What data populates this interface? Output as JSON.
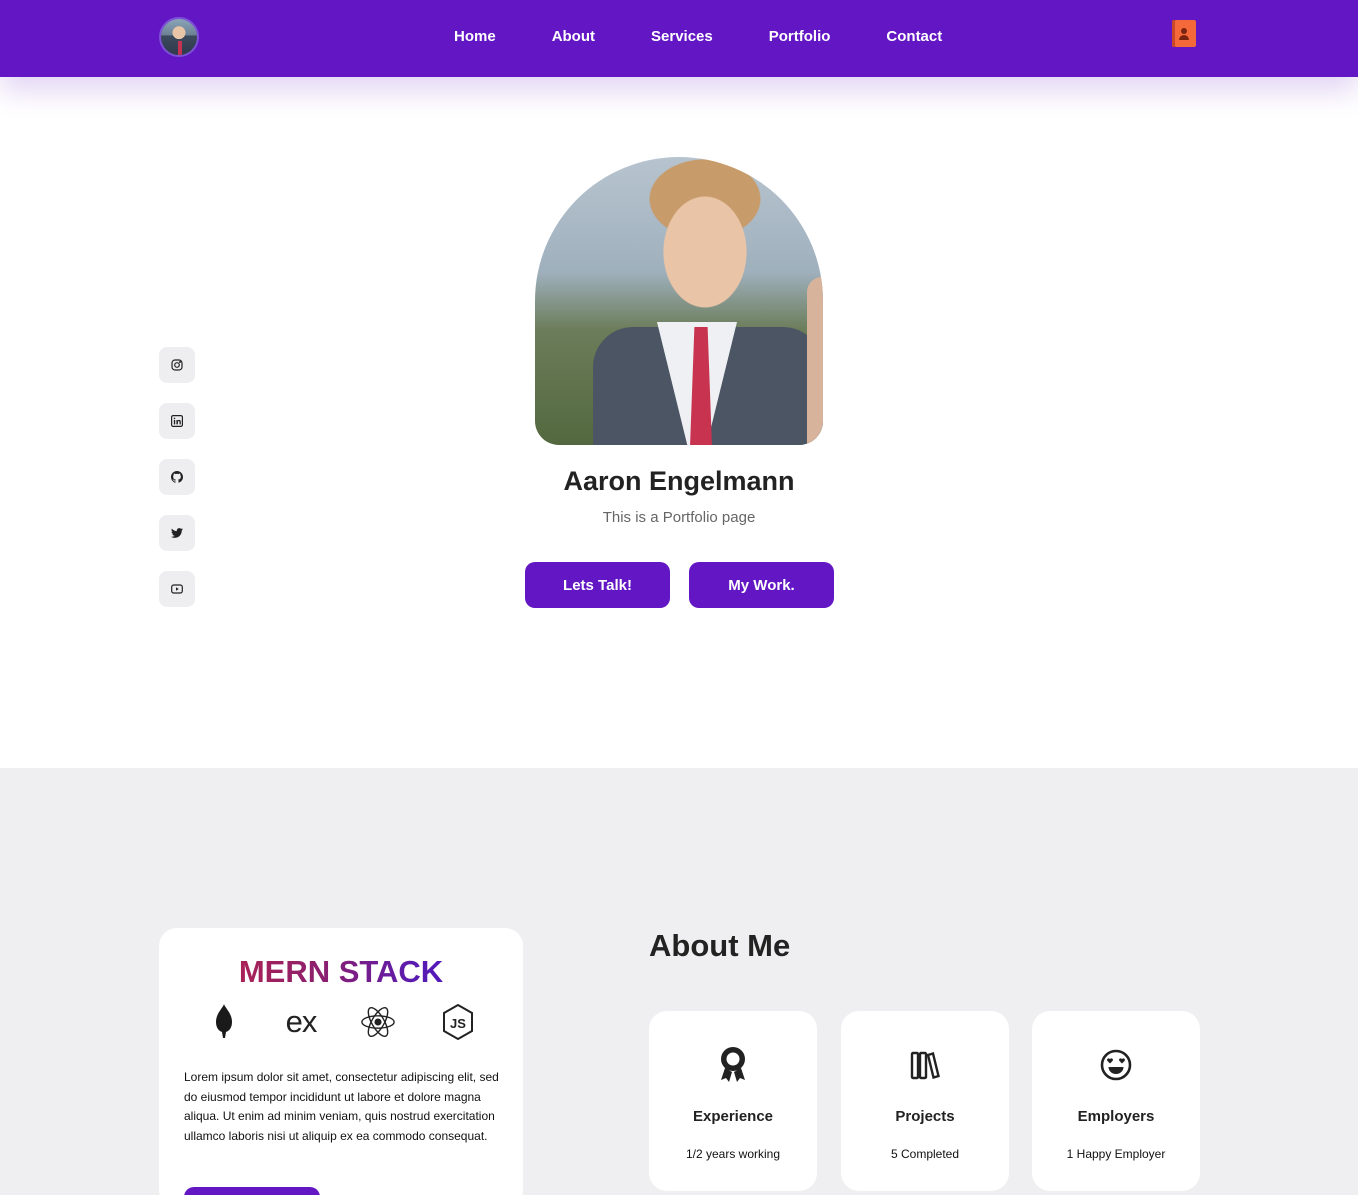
{
  "nav": {
    "links": [
      "Home",
      "About",
      "Services",
      "Portfolio",
      "Contact"
    ]
  },
  "hero": {
    "name": "Aaron Engelmann",
    "subtitle": "This is a Portfolio page",
    "primary_button": "Lets Talk!",
    "secondary_button": "My Work."
  },
  "social": [
    "instagram-icon",
    "linkedin-icon",
    "github-icon",
    "twitter-icon",
    "youtube-icon"
  ],
  "mern": {
    "title": "MERN STACK",
    "tech_icons": [
      "mongodb-icon",
      "express-icon",
      "react-icon",
      "nodejs-icon"
    ],
    "express_glyph": "ex",
    "description": "Lorem ipsum dolor sit amet, consectetur adipiscing elit, sed do eiusmod tempor incididunt ut labore et dolore magna aliqua. Ut enim ad minim veniam, quis nostrud exercitation ullamco laboris nisi ut aliquip ex ea commodo consequat."
  },
  "about": {
    "title": "About Me",
    "cards": [
      {
        "icon": "award-icon",
        "title": "Experience",
        "value": "1/2 years working"
      },
      {
        "icon": "books-icon",
        "title": "Projects",
        "value": "5 Completed"
      },
      {
        "icon": "smile-hearts-icon",
        "title": "Employers",
        "value": "1 Happy Employer"
      }
    ]
  },
  "colors": {
    "brand": "#6216c4",
    "section_bg": "#efeff1",
    "contact_icon": "#f4683a"
  }
}
